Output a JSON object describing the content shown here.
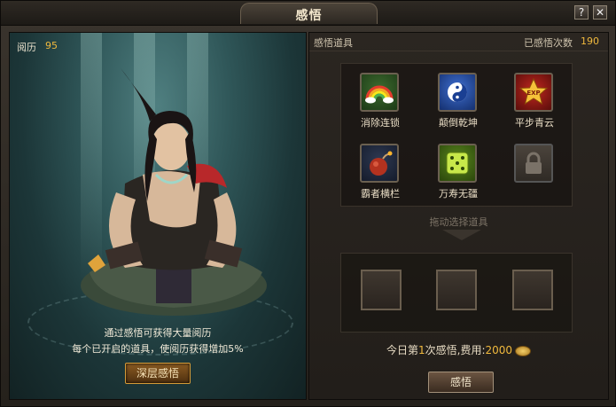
{
  "window": {
    "title": "感悟",
    "help_label": "?",
    "close_label": "✕"
  },
  "left": {
    "exp_label": "阅历",
    "exp_value": "95",
    "desc_line1": "通过感悟可获得大量阅历",
    "desc_line2": "每个已开启的道具，使阅历获得增加5%",
    "deep_button": "深层感悟"
  },
  "right": {
    "items_label": "感悟道具",
    "count_label": "已感悟次数",
    "count_value": "190",
    "items": [
      {
        "label": "消除连锁",
        "icon": "rainbow-icon",
        "locked": false
      },
      {
        "label": "颠倒乾坤",
        "icon": "yin-yang-icon",
        "locked": false
      },
      {
        "label": "平步青云",
        "icon": "exp-star-icon",
        "locked": false
      },
      {
        "label": "霸者横栏",
        "icon": "bomb-icon",
        "locked": false
      },
      {
        "label": "万寿无疆",
        "icon": "dice-icon",
        "locked": false
      },
      {
        "label": "",
        "icon": "lock-icon",
        "locked": true
      }
    ],
    "drag_hint": "拖动选择道具",
    "today_prefix": "今日第",
    "today_count": "1",
    "today_middle": "次感悟,费用:",
    "cost": "2000",
    "wu_button": "感悟"
  },
  "colors": {
    "accent": "#f0b93d",
    "panel_bg": "#2b2621",
    "teal_bg": "#2f5658"
  }
}
